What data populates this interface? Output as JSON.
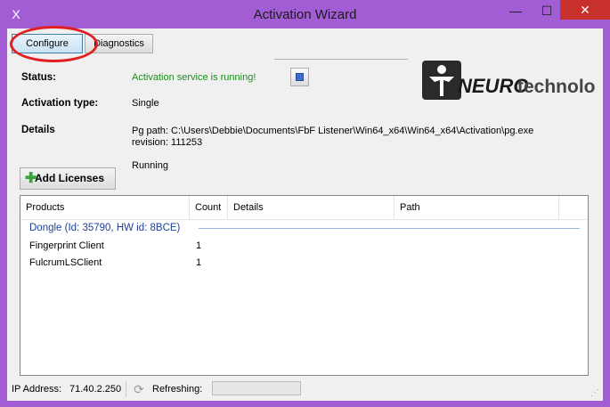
{
  "window": {
    "title": "Activation Wizard",
    "minimize": "—",
    "maximize": "☐",
    "close": "✕",
    "app_icon": "X"
  },
  "toolbar": {
    "configure_label": "Configure",
    "diagnostics_label": "Diagnostics"
  },
  "status": {
    "label": "Status:",
    "value": "Activation service is running!",
    "value_color": "#1e8c1e"
  },
  "activation_type": {
    "label": "Activation type:",
    "value": "Single"
  },
  "details": {
    "label": "Details",
    "pg_path": "Pg path: C:\\Users\\Debbie\\Documents\\FbF Listener\\Win64_x64\\Win64_x64\\Activation\\pg.exe",
    "revision": "revision: 111253",
    "state": "Running"
  },
  "add_licenses_label": "Add Licenses",
  "logo": {
    "part1": "NEURO",
    "part2": "technology"
  },
  "table": {
    "columns": [
      "Products",
      "Count",
      "Details",
      "Path"
    ],
    "group": "Dongle (Id: 35790, HW id: 8BCE)",
    "rows": [
      {
        "product": "Fingerprint Client",
        "count": "1",
        "details": "",
        "path": ""
      },
      {
        "product": "FulcrumLSClient",
        "count": "1",
        "details": "",
        "path": ""
      }
    ]
  },
  "statusbar": {
    "ip_label": "IP Address:",
    "ip_value": "71.40.2.250",
    "refreshing_label": "Refreshing:",
    "refresh_progress": 0
  },
  "colors": {
    "window_frame": "#a25cd4",
    "close_button": "#c7302b",
    "highlight_ellipse": "#e02020"
  }
}
